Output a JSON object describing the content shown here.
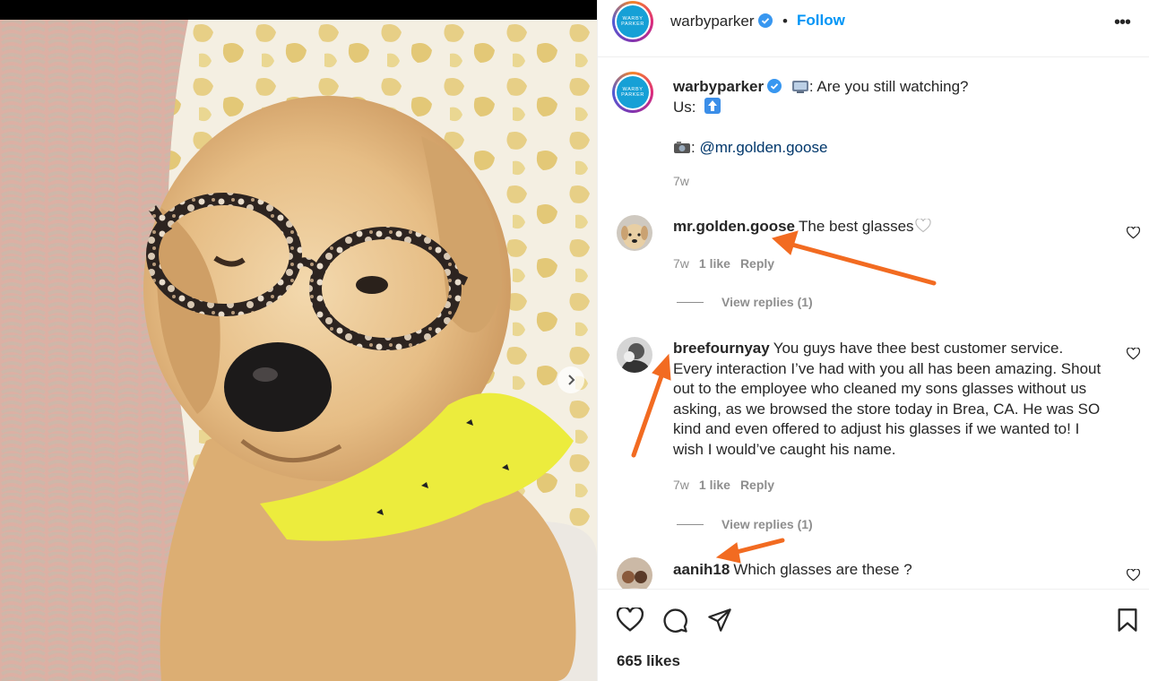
{
  "header": {
    "username": "warbyparker",
    "dot": "•",
    "follow_label": "Follow",
    "more_label": "•••",
    "avatar_text": [
      "WARBY",
      "PARKER"
    ]
  },
  "caption": {
    "username": "warbyparker",
    "line1": ": Are you still watching?",
    "line2": "Us:",
    "line3": ":",
    "mention": "@mr.golden.goose",
    "time": "7w"
  },
  "comments": [
    {
      "username": "mr.golden.goose",
      "text": "The best glasses",
      "time": "7w",
      "likes": "1 like",
      "reply": "Reply",
      "view_replies": "View replies (1)"
    },
    {
      "username": "breefournyay",
      "text": "You guys have thee best customer service. Every interaction I’ve had with you all has been amazing. Shout out to the employee who cleaned my sons glasses without us asking, as we browsed the store today in Brea, CA. He was SO kind and even offered to adjust his glasses if we wanted to! I wish I would’ve caught his name.",
      "time": "7w",
      "likes": "1 like",
      "reply": "Reply",
      "view_replies": "View replies (1)"
    },
    {
      "username": "aanih18",
      "text": "Which glasses are these ?"
    }
  ],
  "footer": {
    "likes": "665 likes"
  },
  "colors": {
    "follow": "#0095f6",
    "verified": "#0095f6",
    "annotation_arrow": "#f26b21"
  },
  "icons": [
    "verified-badge-icon",
    "heart-icon",
    "comment-icon",
    "share-icon",
    "bookmark-icon",
    "chevron-right-icon",
    "more-icon"
  ]
}
